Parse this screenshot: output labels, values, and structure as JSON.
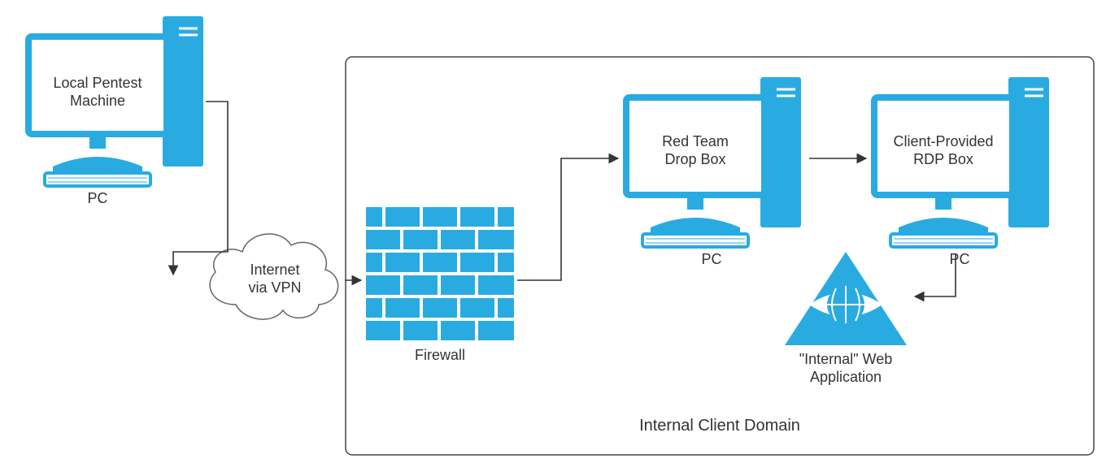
{
  "nodes": {
    "local_pc": {
      "label": "Local Pentest\nMachine",
      "caption": "PC"
    },
    "cloud": {
      "label": "Internet\nvia VPN"
    },
    "firewall": {
      "caption": "Firewall"
    },
    "dropbox": {
      "label": "Red Team\nDrop Box",
      "caption": "PC"
    },
    "rdpbox": {
      "label": "Client-Provided\nRDP Box",
      "caption": "PC"
    },
    "webapp": {
      "caption": "\"Internal\" Web\nApplication"
    }
  },
  "domain": {
    "label": "Internal Client Domain"
  },
  "icons": {
    "pc": "pc-icon",
    "cloud": "cloud-icon",
    "firewall": "firewall-icon",
    "webserver": "webserver-icon"
  },
  "colors": {
    "accent": "#29abe2",
    "stroke": "#333333"
  }
}
